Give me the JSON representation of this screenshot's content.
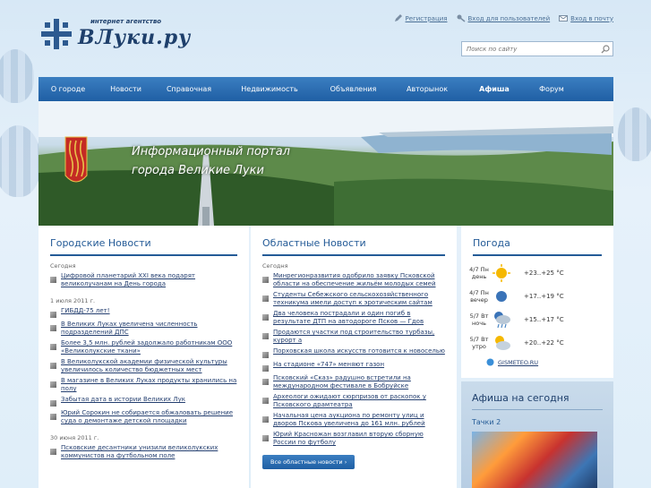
{
  "logo": {
    "tagline": "интернет агентство",
    "name": "ВЛуки.ру"
  },
  "toplinks": [
    {
      "label": "Регистрация",
      "icon": "pencil-icon"
    },
    {
      "label": "Вход для пользователей",
      "icon": "key-icon"
    },
    {
      "label": "Вход в почту",
      "icon": "mail-icon"
    }
  ],
  "search": {
    "placeholder": "Поиск по сайту"
  },
  "nav": [
    {
      "label": "О городе"
    },
    {
      "label": "Новости"
    },
    {
      "label": "Справочная"
    },
    {
      "label": "Недвижимость"
    },
    {
      "label": "Объявления"
    },
    {
      "label": "Авторынок"
    },
    {
      "label": "Афиша"
    },
    {
      "label": "Форум"
    }
  ],
  "banner": {
    "line1": "Информационный портал",
    "line2": "города Великие Луки"
  },
  "city_news": {
    "title": "Городские Новости",
    "groups": [
      {
        "date": "Сегодня",
        "items": [
          "Цифровой планетарий XXI века подарят великолучанам на День города"
        ]
      },
      {
        "date": "1 июля 2011 г.",
        "items": [
          "ГИБДД-75 лет!",
          "В Великих Луках увеличена численность подразделений ДПС",
          "Более 3,5 млн. рублей задолжало работникам ООО «Великолукские ткани»",
          "В Великолукской академии физической культуры увеличилось количество бюджетных мест",
          "В магазине в Великих Луках продукты хранились на полу",
          "Забытая дата в истории Великих Лук",
          "Юрий Сорокин не собирается обжаловать решение суда о демонтаже детской площадки"
        ]
      },
      {
        "date": "30 июня 2011 г.",
        "items": [
          "Псковские десантники унизили великолукских коммунистов на футбольном поле"
        ]
      }
    ]
  },
  "region_news": {
    "title": "Областные Новости",
    "groups": [
      {
        "date": "Сегодня",
        "items": [
          "Минрегионразвития одобрило заявку Псковской области на обеспечение жильём молодых семей",
          "Студенты Себежского сельскохозяйственного техникума имели доступ к эротическим сайтам",
          "Два человека пострадали и один погиб в результате ДТП на автодороге Псков — Гдов",
          "Продаются участки под строительство турбазы, курорт а",
          "Порховская школа искусств готовится к новоселью",
          "На стадионе «747» меняют газон",
          "Псковский «Сказ» радушно встретили на международном фестивале в Бобруйске",
          "Археологи ожидают сюрпризов от раскопок у Псковского драмтеатра",
          "Начальная цена аукциона по ремонту улиц и дворов Пскова увеличена до 161 млн. рублей",
          "Юрий Красножан возглавил вторую сборную России по футболу"
        ]
      }
    ],
    "all_button": "Все областные новости"
  },
  "weather": {
    "title": "Погода",
    "rows": [
      {
        "day": "4/7 Пн",
        "part": "день",
        "temp": "+23..+25 °C",
        "icon": "sun-icon"
      },
      {
        "day": "4/7 Пн",
        "part": "вечер",
        "temp": "+17..+19 °C",
        "icon": "moon-icon"
      },
      {
        "day": "5/7 Вт",
        "part": "ночь",
        "temp": "+15..+17 °C",
        "icon": "cloud-rain-icon"
      },
      {
        "day": "5/7 Вт",
        "part": "утро",
        "temp": "+20..+22 °C",
        "icon": "sun-cloud-icon"
      }
    ],
    "source": "GISMETEO.RU"
  },
  "afisha": {
    "title": "Афиша на сегодня",
    "film": "Тачки 2"
  },
  "colors": {
    "nav": "#2a6db3",
    "heading": "#245b97",
    "link": "#243f70"
  }
}
